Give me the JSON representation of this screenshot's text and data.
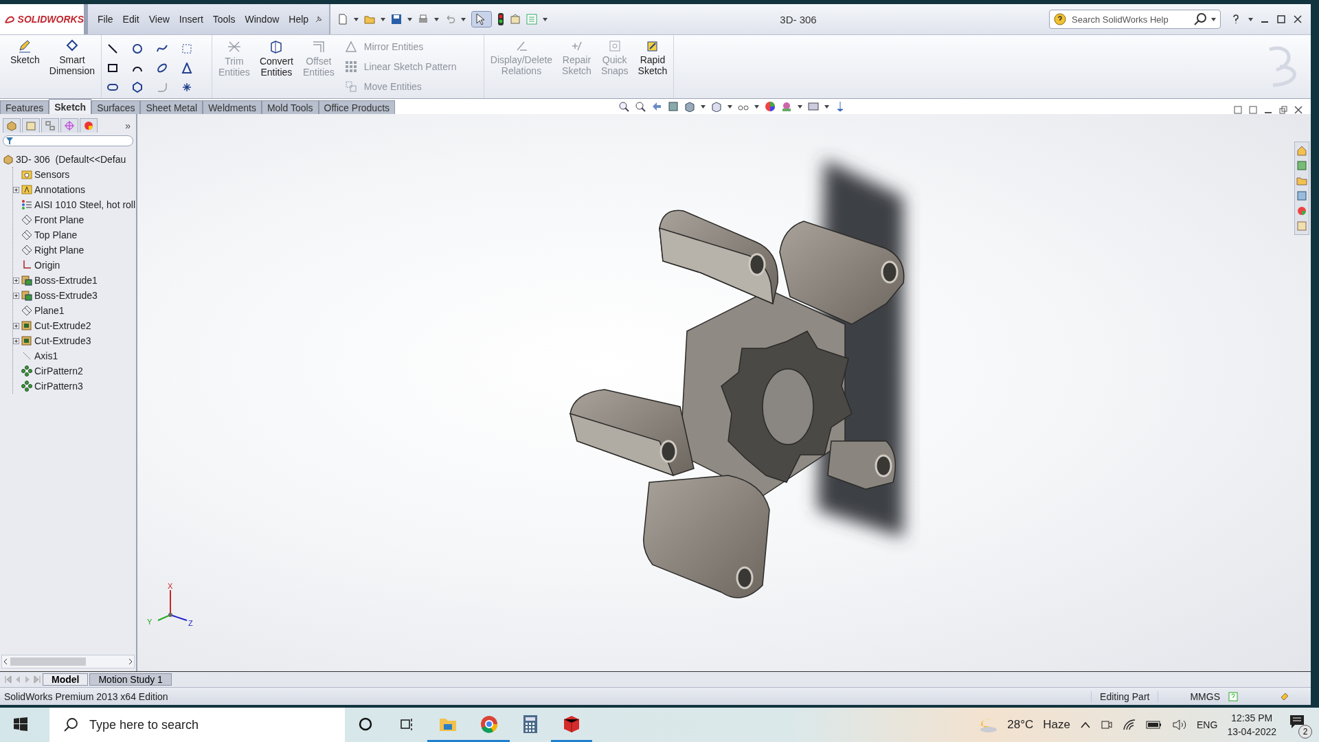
{
  "app": {
    "logo": "SOLIDWORKS",
    "menu": [
      "File",
      "Edit",
      "View",
      "Insert",
      "Tools",
      "Window",
      "Help"
    ],
    "title": "3D- 306",
    "help_search": {
      "placeholder": "Search SolidWorks Help"
    }
  },
  "ribbon": {
    "left": [
      {
        "kind": "pencil",
        "label": "Sketch",
        "disabled": false
      },
      {
        "kind": "dimension",
        "label": "Smart Dimension",
        "disabled": false
      }
    ],
    "middle": [
      {
        "kind": "trim",
        "label": "Trim Entities",
        "disabled": true
      },
      {
        "kind": "convert",
        "label": "Convert Entities",
        "disabled": false
      },
      {
        "kind": "offset",
        "label": "Offset Entities",
        "disabled": true
      }
    ],
    "list": [
      {
        "kind": "mirror",
        "label": "Mirror Entities",
        "disabled": true
      },
      {
        "kind": "pattern",
        "label": "Linear Sketch Pattern",
        "disabled": true
      },
      {
        "kind": "move",
        "label": "Move Entities",
        "disabled": true
      }
    ],
    "right": [
      {
        "kind": "relations",
        "label": "Display/Delete Relations",
        "disabled": true
      },
      {
        "kind": "repair",
        "label": "Repair Sketch",
        "disabled": true
      },
      {
        "kind": "snaps",
        "label": "Quick Snaps",
        "disabled": true
      },
      {
        "kind": "rapid",
        "label": "Rapid Sketch",
        "disabled": false
      }
    ]
  },
  "command_tabs": [
    {
      "label": "Features",
      "selected": false
    },
    {
      "label": "Sketch",
      "selected": true
    },
    {
      "label": "Surfaces",
      "selected": false
    },
    {
      "label": "Sheet Metal",
      "selected": false
    },
    {
      "label": "Weldments",
      "selected": false
    },
    {
      "label": "Mold Tools",
      "selected": false
    },
    {
      "label": "Office Products",
      "selected": false
    }
  ],
  "tree": {
    "more": "»",
    "root": {
      "label": "3D- 306  (Default<<Defau",
      "kind": "part",
      "children": [
        {
          "label": "Sensors",
          "kind": "sensor",
          "collapsible": false
        },
        {
          "label": "Annotations",
          "kind": "annotation",
          "collapsible": true
        },
        {
          "label": "AISI 1010 Steel, hot roll",
          "kind": "material",
          "collapsible": false
        },
        {
          "label": "Front Plane",
          "kind": "plane",
          "collapsible": false
        },
        {
          "label": "Top Plane",
          "kind": "plane",
          "collapsible": false
        },
        {
          "label": "Right Plane",
          "kind": "plane",
          "collapsible": false
        },
        {
          "label": "Origin",
          "kind": "origin",
          "collapsible": false
        },
        {
          "label": "Boss-Extrude1",
          "kind": "boss",
          "collapsible": true
        },
        {
          "label": "Boss-Extrude3",
          "kind": "boss",
          "collapsible": true
        },
        {
          "label": "Plane1",
          "kind": "plane",
          "collapsible": false
        },
        {
          "label": "Cut-Extrude2",
          "kind": "cut",
          "collapsible": true
        },
        {
          "label": "Cut-Extrude3",
          "kind": "cut",
          "collapsible": true
        },
        {
          "label": "Axis1",
          "kind": "axis",
          "collapsible": false
        },
        {
          "label": "CirPattern2",
          "kind": "pattern",
          "collapsible": false
        },
        {
          "label": "CirPattern3",
          "kind": "pattern",
          "collapsible": false
        }
      ]
    }
  },
  "triad": {
    "x": "X",
    "y": "Y",
    "z": "Z"
  },
  "bottom_tabs": [
    {
      "label": "Model",
      "selected": true
    },
    {
      "label": "Motion Study 1",
      "selected": false
    }
  ],
  "status_bar": {
    "edition": "SolidWorks Premium 2013 x64 Edition",
    "mode": "Editing Part",
    "units": "MMGS"
  },
  "taskbar": {
    "search": {
      "placeholder": "Type here to search"
    },
    "apps": [
      {
        "kind": "folder",
        "active": true
      },
      {
        "kind": "browser",
        "active": true
      },
      {
        "kind": "calculator",
        "active": false
      },
      {
        "kind": "cad",
        "active": true
      }
    ],
    "weather": {
      "temperature": "28°C",
      "condition": "Haze"
    },
    "language": "ENG",
    "time": "12:35 PM",
    "date": "13-04-2022",
    "notifications": "2"
  }
}
